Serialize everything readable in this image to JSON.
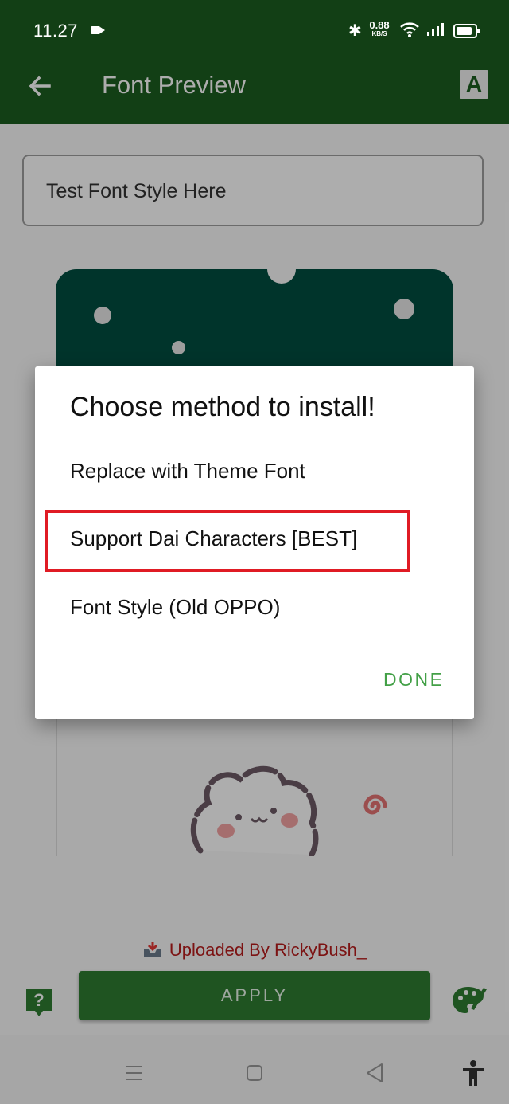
{
  "status_bar": {
    "time": "11.27",
    "net_speed_value": "0.88",
    "net_speed_unit": "KB/S",
    "bluetooth_glyph": "✱"
  },
  "app_bar": {
    "title": "Font Preview",
    "font_icon_label": "A"
  },
  "preview": {
    "input_text": "Test Font Style Here"
  },
  "footer": {
    "uploaded_by": "Uploaded By RickyBush_",
    "apply_label": "APPLY"
  },
  "dialog": {
    "title": "Choose method to install!",
    "options": [
      {
        "label": "Replace with Theme Font"
      },
      {
        "label": "Support Dai Characters [BEST]",
        "highlighted": true
      },
      {
        "label": "Font Style (Old OPPO)"
      }
    ],
    "done_label": "DONE"
  },
  "colors": {
    "app_bar": "#1b5e20",
    "apply_button": "#2e7d32",
    "done_text": "#43a047",
    "highlight_border": "#e01b24",
    "uploaded_text": "#b71c1c"
  },
  "icons": {
    "back": "arrow-left-icon",
    "font": "font-a-icon",
    "help": "help-icon",
    "palette": "palette-icon",
    "nav_menu": "menu-icon",
    "nav_home": "home-icon",
    "nav_back": "back-triangle-icon",
    "accessibility": "accessibility-icon"
  }
}
